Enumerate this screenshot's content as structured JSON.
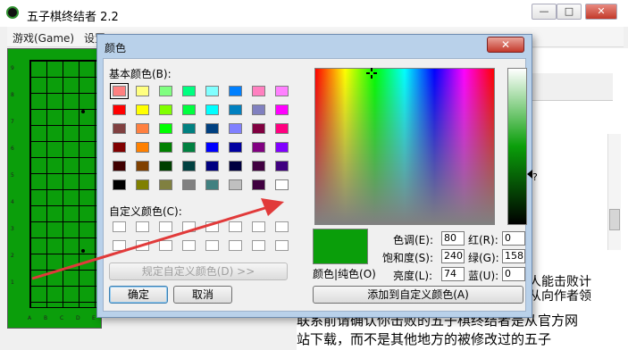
{
  "main": {
    "title": "五子棋终结者 2.2",
    "menu": [
      "游戏(Game)",
      "设置"
    ]
  },
  "board": {
    "row_labels": [
      "9",
      "8",
      "7",
      "6",
      "5",
      "4",
      "3",
      "2",
      "1"
    ],
    "col_labels": [
      "A",
      "B",
      "C",
      "D",
      "E"
    ]
  },
  "side": {
    "partial_lines": [
      "人能击败计",
      "从向作者领"
    ],
    "question_mark": "?"
  },
  "lower_text": {
    "line1": "联系前请确认你击败的五子棋终结者是从官方网",
    "line2": "站下载，而不是其他地方的被修改过的五子"
  },
  "dialog": {
    "title": "颜色",
    "close": "✕",
    "basic_colors_label": "基本颜色(B):",
    "custom_colors_label": "自定义颜色(C):",
    "define_custom_button": "规定自定义颜色(D) >>",
    "ok_button": "确定",
    "cancel_button": "取消",
    "color_solid_label": "颜色|纯色(O)",
    "hue_label": "色调(E):",
    "hue_value": "80",
    "sat_label": "饱和度(S):",
    "sat_value": "240",
    "lum_label": "亮度(L):",
    "lum_value": "74",
    "red_label": "红(R):",
    "red_value": "0",
    "green_label": "绿(G):",
    "green_value": "158",
    "blue_label": "蓝(U):",
    "blue_value": "0",
    "add_custom_button": "添加到自定义颜色(A)"
  },
  "colors": {
    "basic": [
      [
        "#ff8080",
        "#ffff80",
        "#80ff80",
        "#00ff80",
        "#80ffff",
        "#0080ff",
        "#ff80c0",
        "#ff80ff"
      ],
      [
        "#ff0000",
        "#ffff00",
        "#80ff00",
        "#00ff40",
        "#00ffff",
        "#0080c0",
        "#8080c0",
        "#ff00ff"
      ],
      [
        "#804040",
        "#ff8040",
        "#00ff00",
        "#008080",
        "#004080",
        "#8080ff",
        "#800040",
        "#ff0080"
      ],
      [
        "#800000",
        "#ff8000",
        "#008000",
        "#008040",
        "#0000ff",
        "#0000a0",
        "#800080",
        "#8000ff"
      ],
      [
        "#400000",
        "#804000",
        "#004000",
        "#004040",
        "#000080",
        "#000040",
        "#400040",
        "#400080"
      ],
      [
        "#000000",
        "#808000",
        "#808040",
        "#808080",
        "#408080",
        "#c0c0c0",
        "#400040",
        "#ffffff"
      ]
    ],
    "current": "#0a9e0a"
  }
}
